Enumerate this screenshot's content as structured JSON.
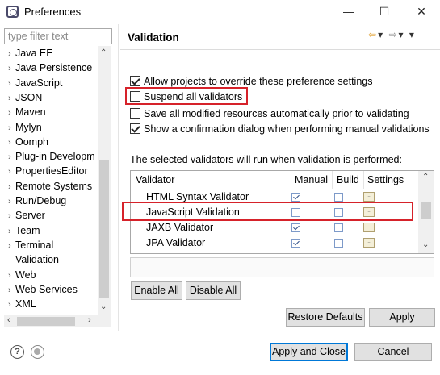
{
  "window": {
    "title": "Preferences",
    "minimize": "—",
    "maximize": "☐",
    "close": "✕"
  },
  "filter": {
    "placeholder": "type filter text"
  },
  "tree": {
    "items": [
      {
        "label": "Java EE",
        "chevron": "›"
      },
      {
        "label": "Java Persistence",
        "chevron": "›"
      },
      {
        "label": "JavaScript",
        "chevron": "›"
      },
      {
        "label": "JSON",
        "chevron": "›"
      },
      {
        "label": "Maven",
        "chevron": "›"
      },
      {
        "label": "Mylyn",
        "chevron": "›"
      },
      {
        "label": "Oomph",
        "chevron": "›"
      },
      {
        "label": "Plug-in Developm",
        "chevron": "›"
      },
      {
        "label": "PropertiesEditor",
        "chevron": "›"
      },
      {
        "label": "Remote Systems",
        "chevron": "›"
      },
      {
        "label": "Run/Debug",
        "chevron": "›"
      },
      {
        "label": "Server",
        "chevron": "›"
      },
      {
        "label": "Team",
        "chevron": "›"
      },
      {
        "label": "Terminal",
        "chevron": "›"
      },
      {
        "label": "Validation",
        "chevron": ""
      },
      {
        "label": "Web",
        "chevron": "›"
      },
      {
        "label": "Web Services",
        "chevron": "›"
      },
      {
        "label": "XML",
        "chevron": "›"
      }
    ],
    "selected": "Validation"
  },
  "page": {
    "title": "Validation",
    "nav": {
      "back": "⇦",
      "back_menu": "▾",
      "forward": "⇨",
      "forward_menu": "▾",
      "view_menu": "▾"
    }
  },
  "options": [
    {
      "label": "Allow projects to override these preference settings",
      "checked": true
    },
    {
      "label": "Suspend all validators",
      "checked": false
    },
    {
      "label": "Save all modified resources automatically prior to validating",
      "checked": false
    },
    {
      "label": "Show a confirmation dialog when performing manual validations",
      "checked": true
    }
  ],
  "info_text": "The selected validators will run when validation is performed:",
  "table": {
    "headers": {
      "validator": "Validator",
      "manual": "Manual",
      "build": "Build",
      "settings": "Settings"
    },
    "rows": [
      {
        "name": "HTML Syntax Validator",
        "manual": true,
        "build": false,
        "settings": "..."
      },
      {
        "name": "JavaScript Validation",
        "manual": false,
        "build": false,
        "settings": "..."
      },
      {
        "name": "JAXB Validator",
        "manual": true,
        "build": false,
        "settings": "..."
      },
      {
        "name": "JPA Validator",
        "manual": true,
        "build": false,
        "settings": "..."
      }
    ]
  },
  "buttons": {
    "enable_all": "Enable All",
    "disable_all": "Disable All",
    "restore_defaults": "Restore Defaults",
    "apply": "Apply",
    "apply_and_close": "Apply and Close",
    "cancel": "Cancel"
  },
  "footer": {
    "help": "?"
  },
  "colors": {
    "highlight": "#d6222a",
    "default_button": "#0078d7"
  }
}
